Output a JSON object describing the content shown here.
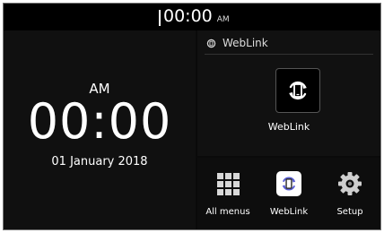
{
  "status_bar": {
    "time": "00:00",
    "ampm": "AM"
  },
  "clock_widget": {
    "ampm": "AM",
    "time": "00:00",
    "date": "01 January 2018"
  },
  "weblink_panel": {
    "header": "WebLink",
    "header_icon": "weblink-outline-icon",
    "app_icon": "weblink-phone-icon",
    "app_label": "WebLink"
  },
  "dock": {
    "items": [
      {
        "label": "All menus",
        "icon": "grid-icon"
      },
      {
        "label": "WebLink",
        "icon": "weblink-phone-icon"
      },
      {
        "label": "Setup",
        "icon": "gear-icon"
      }
    ]
  },
  "colors": {
    "background": "#0a0a0a",
    "text": "#ffffff",
    "weblink_accent": "#5a5fd6"
  }
}
